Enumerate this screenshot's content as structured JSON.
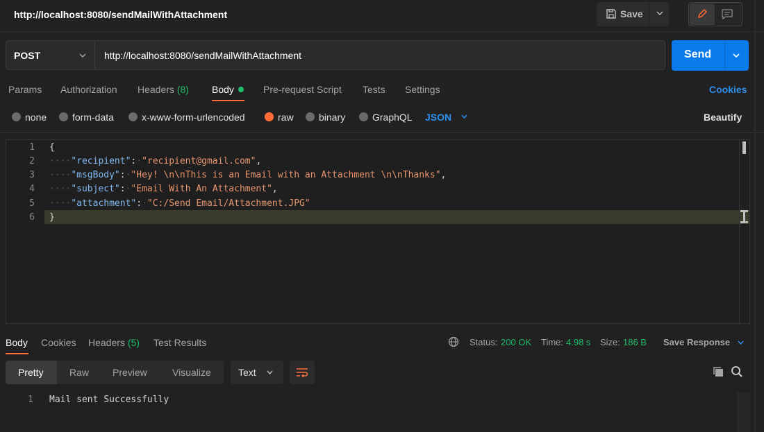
{
  "window": {
    "title": "http://localhost:8080/sendMailWithAttachment"
  },
  "toolbar": {
    "save_label": "Save"
  },
  "request": {
    "method": "POST",
    "url": "http://localhost:8080/sendMailWithAttachment",
    "send_label": "Send",
    "tabs": [
      {
        "label": "Params"
      },
      {
        "label": "Authorization"
      },
      {
        "label": "Headers",
        "count": "(8)"
      },
      {
        "label": "Body"
      },
      {
        "label": "Pre-request Script"
      },
      {
        "label": "Tests"
      },
      {
        "label": "Settings"
      }
    ],
    "cookies_label": "Cookies",
    "body_types": [
      "none",
      "form-data",
      "x-www-form-urlencoded",
      "raw",
      "binary",
      "GraphQL"
    ],
    "selected_body_type": "raw",
    "format": "JSON",
    "beautify_label": "Beautify",
    "line_numbers": [
      "1",
      "2",
      "3",
      "4",
      "5",
      "6"
    ],
    "code": {
      "open": "{",
      "close": "}",
      "fields": [
        {
          "key": "\"recipient\"",
          "value": "\"recipient@gmail.com\"",
          "comma": ","
        },
        {
          "key": "\"msgBody\"",
          "value": "\"Hey! \\n\\nThis is an Email with an Attachment \\n\\nThanks\"",
          "comma": ","
        },
        {
          "key": "\"subject\"",
          "value": "\"Email With An Attachment\"",
          "comma": ","
        },
        {
          "key": "\"attachment\"",
          "value": "\"C:/Send Email/Attachment.JPG\"",
          "comma": ""
        }
      ]
    }
  },
  "response": {
    "tabs": [
      {
        "label": "Body"
      },
      {
        "label": "Cookies"
      },
      {
        "label": "Headers",
        "count": "(5)"
      },
      {
        "label": "Test Results"
      }
    ],
    "status_label": "Status:",
    "status_value": "200 OK",
    "time_label": "Time:",
    "time_value": "4.98 s",
    "size_label": "Size:",
    "size_value": "186 B",
    "save_response_label": "Save Response",
    "views": [
      "Pretty",
      "Raw",
      "Preview",
      "Visualize"
    ],
    "format": "Text",
    "line_number": "1",
    "body_text": "Mail sent Successfully"
  },
  "colors": {
    "accent_orange": "#ff6c37",
    "send_blue": "#097bed",
    "link_blue": "#2f8fec",
    "success_green": "#1fbd6c"
  },
  "icons": [
    "save-icon",
    "chevron-down-icon",
    "pencil-icon",
    "comment-icon",
    "globe-icon",
    "copy-icon",
    "search-icon",
    "wrap-lines-icon"
  ]
}
